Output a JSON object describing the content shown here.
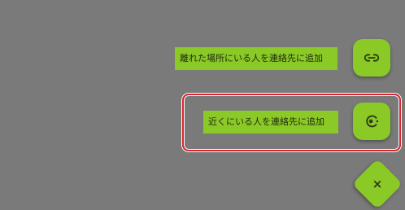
{
  "actions": {
    "remote_label": "離れた場所にいる人を連絡先に追加",
    "remote_icon": "link-icon",
    "nearby_label": "近くにいる人を連絡先に追加",
    "nearby_icon": "nearby-icon",
    "close_icon": "close-icon",
    "close_symbol": "×"
  },
  "colors": {
    "accent": "#8ac926",
    "overlay": "#7a7a7a",
    "highlight": "#d7262e"
  }
}
